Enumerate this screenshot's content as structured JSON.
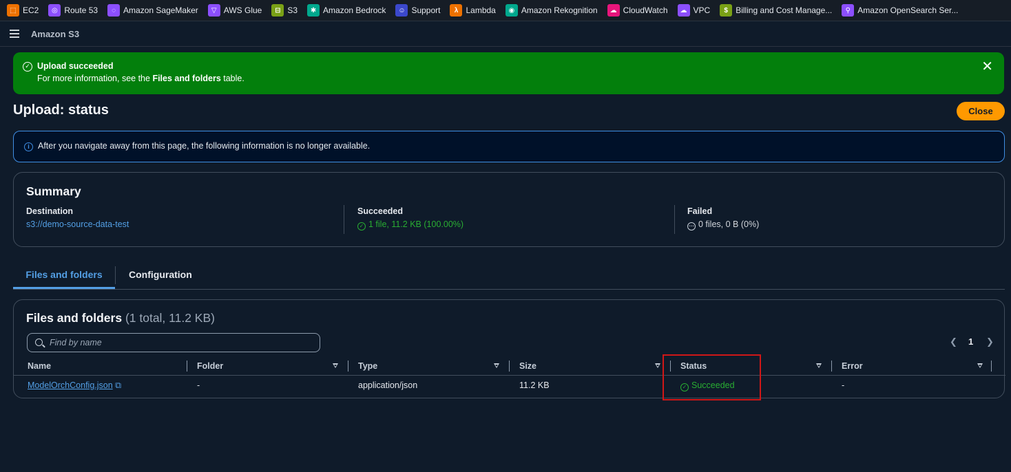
{
  "favorites": [
    {
      "label": "EC2",
      "icon": "ec2-icon",
      "color": "#ed7100"
    },
    {
      "label": "Route 53",
      "icon": "route53-icon",
      "color": "#8c4fff"
    },
    {
      "label": "Amazon SageMaker",
      "icon": "sagemaker-icon",
      "color": "#8c4fff"
    },
    {
      "label": "AWS Glue",
      "icon": "glue-icon",
      "color": "#8c4fff"
    },
    {
      "label": "S3",
      "icon": "s3-icon",
      "color": "#7aa116"
    },
    {
      "label": "Amazon Bedrock",
      "icon": "bedrock-icon",
      "color": "#01a88d"
    },
    {
      "label": "Support",
      "icon": "support-icon",
      "color": "#3b48cc"
    },
    {
      "label": "Lambda",
      "icon": "lambda-icon",
      "color": "#ed7100"
    },
    {
      "label": "Amazon Rekognition",
      "icon": "rekognition-icon",
      "color": "#01a88d"
    },
    {
      "label": "CloudWatch",
      "icon": "cloudwatch-icon",
      "color": "#e7157b"
    },
    {
      "label": "VPC",
      "icon": "vpc-icon",
      "color": "#8c4fff"
    },
    {
      "label": "Billing and Cost Manage...",
      "icon": "billing-icon",
      "color": "#7aa116"
    },
    {
      "label": "Amazon OpenSearch Ser...",
      "icon": "opensearch-icon",
      "color": "#8c4fff"
    }
  ],
  "nav": {
    "service_name": "Amazon S3"
  },
  "flash": {
    "title": "Upload succeeded",
    "body_prefix": "For more information, see the ",
    "body_bold": "Files and folders",
    "body_suffix": " table."
  },
  "page": {
    "title": "Upload: status",
    "close_label": "Close"
  },
  "info": {
    "text": "After you navigate away from this page, the following information is no longer available."
  },
  "summary": {
    "title": "Summary",
    "destination_label": "Destination",
    "destination_value": "s3://demo-source-data-test",
    "succeeded_label": "Succeeded",
    "succeeded_value": "1 file, 11.2 KB (100.00%)",
    "failed_label": "Failed",
    "failed_value": "0 files, 0 B (0%)"
  },
  "tabs": [
    {
      "label": "Files and folders",
      "active": true
    },
    {
      "label": "Configuration",
      "active": false
    }
  ],
  "files": {
    "title": "Files and folders",
    "count": "(1 total, 11.2 KB)",
    "search_placeholder": "Find by name",
    "page": "1",
    "columns": [
      "Name",
      "Folder",
      "Type",
      "Size",
      "Status",
      "Error"
    ],
    "rows": [
      {
        "name": "ModelOrchConfig.json",
        "folder": "-",
        "type": "application/json",
        "size": "11.2 KB",
        "status": "Succeeded",
        "error": "-"
      }
    ]
  },
  "colors": {
    "success": "#037f0c",
    "accent": "#ff9900",
    "link": "#539fe5",
    "highlight": "#d01717"
  }
}
